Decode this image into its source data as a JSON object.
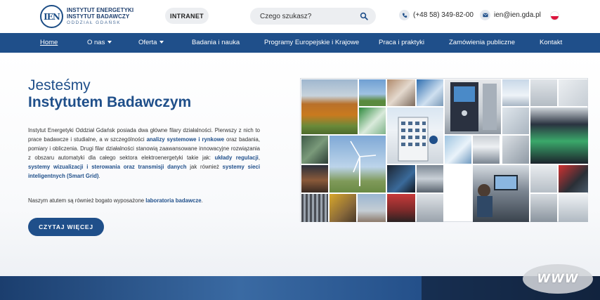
{
  "header": {
    "logo": {
      "mark": "IEN",
      "line1": "INSTYTUT ENERGETYKI",
      "line2": "INSTYTUT BADAWCZY",
      "line3": "ODDZIAŁ GDAŃSK"
    },
    "intranet_label": "INTRANET",
    "search_placeholder": "Czego szukasz?",
    "phone": "(+48 58) 349-82-00",
    "email": "ien@ien.gda.pl",
    "language_flag": "pl-flag"
  },
  "nav": {
    "items": [
      {
        "label": "Home",
        "active": true
      },
      {
        "label": "O nas",
        "dropdown": true
      },
      {
        "label": "Oferta",
        "dropdown": true
      },
      {
        "label": "Badania i nauka"
      },
      {
        "label": "Programy Europejskie i Krajowe"
      },
      {
        "label": "Praca i praktyki"
      },
      {
        "label": "Zamówienia publiczne"
      },
      {
        "label": "Kontakt"
      }
    ]
  },
  "hero": {
    "title_line1": "Jesteśmy",
    "title_line2": "Instytutem Badawczym",
    "p1_a": "Instytut Energetyki Oddział Gdańsk posiada dwa główne filary działalności. Pierwszy z nich to prace badawcze i studialne, a w szczególności ",
    "p1_b": "analizy systemowe i rynkowe",
    "p1_c": " oraz badania, pomiary i obliczenia. Drugi filar działalności stanowią zaawansowane innowacyjne rozwiązania z obszaru automatyki dla całego sektora elektroenergetyki takie jak: ",
    "p1_d": "układy regulacji",
    "p1_e": ", ",
    "p1_f": "systemy wizualizacji i sterowania oraz transmisji danych",
    "p1_g": " jak również ",
    "p1_h": "systemy sieci inteligentnych (Smart Grid)",
    "p1_i": ".",
    "p2_a": "Naszym atutem są również bogato wyposażone ",
    "p2_b": "laboratoria badawcze",
    "p2_c": ".",
    "cta_label": "CZYTAJ WIĘCEJ"
  },
  "badge": {
    "label": "WWW"
  },
  "colors": {
    "brand": "#1f4f8a",
    "nav_bg": "#1f4f8a",
    "pill_bg": "#eceef1"
  }
}
